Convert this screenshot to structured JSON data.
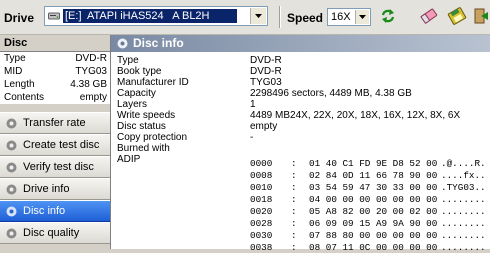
{
  "toolbar": {
    "drive_label": "Drive",
    "drive_value": "[E:]  ATAPI iHAS524   A BL2H",
    "speed_label": "Speed",
    "speed_value": "16X",
    "buttons": [
      "refresh-icon",
      "erase-icon",
      "save-icon",
      "exit-icon"
    ]
  },
  "sidebar": {
    "disc_header": "Disc",
    "disc_info": [
      {
        "k": "Type",
        "v": "DVD-R"
      },
      {
        "k": "MID",
        "v": "TYG03"
      },
      {
        "k": "Length",
        "v": "4.38 GB"
      },
      {
        "k": "Contents",
        "v": "empty"
      }
    ],
    "items": [
      {
        "label": "Transfer rate",
        "active": false
      },
      {
        "label": "Create test disc",
        "active": false
      },
      {
        "label": "Verify test disc",
        "active": false
      },
      {
        "label": "Drive info",
        "active": false
      },
      {
        "label": "Disc info",
        "active": true
      },
      {
        "label": "Disc quality",
        "active": false
      }
    ]
  },
  "panel": {
    "title": "Disc info",
    "rows": [
      {
        "k": "Type",
        "v": "DVD-R"
      },
      {
        "k": "Book type",
        "v": "DVD-R"
      },
      {
        "k": "Manufacturer ID",
        "v": "TYG03"
      },
      {
        "k": "Capacity",
        "v": "2298496 sectors, 4489 MB, 4.38 GB"
      },
      {
        "k": "Layers",
        "v": "1"
      },
      {
        "k": "Write speeds",
        "v": "4489 MB24X, 22X, 20X, 18X, 16X, 12X, 8X, 6X"
      },
      {
        "k": "Disc status",
        "v": "empty"
      },
      {
        "k": "Copy protection",
        "v": "-"
      },
      {
        "k": "Burned with",
        "v": ""
      },
      {
        "k": "ADIP",
        "v": ""
      }
    ],
    "hex": [
      {
        "addr": "0000",
        "bytes": "01 40 C1 FD 9E D8 52 00",
        "text": ".@....R."
      },
      {
        "addr": "0008",
        "bytes": "02 84 0D 11 66 78 90 00",
        "text": "....fx.."
      },
      {
        "addr": "0010",
        "bytes": "03 54 59 47 30 33 00 00",
        "text": ".TYG03.."
      },
      {
        "addr": "0018",
        "bytes": "04 00 00 00 00 00 00 00",
        "text": "........"
      },
      {
        "addr": "0020",
        "bytes": "05 A8 82 00 20 00 02 00",
        "text": "........"
      },
      {
        "addr": "0028",
        "bytes": "06 09 09 15 A9 9A 90 00",
        "text": "........"
      },
      {
        "addr": "0030",
        "bytes": "07 88 80 00 00 00 00 00",
        "text": "........"
      },
      {
        "addr": "0038",
        "bytes": "08 07 11 0C 00 00 00 00",
        "text": "........"
      }
    ]
  }
}
